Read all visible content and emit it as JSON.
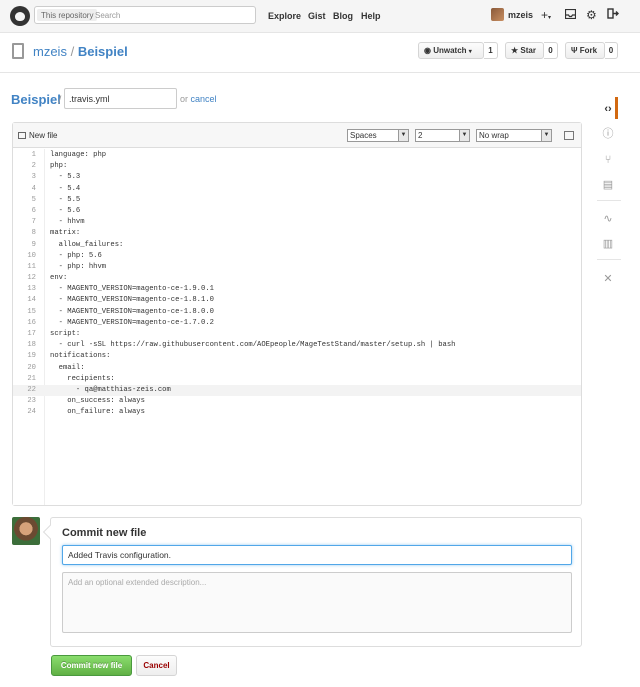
{
  "header": {
    "search_scope": "This repository",
    "search_placeholder": "Search",
    "nav": [
      "Explore",
      "Gist",
      "Blog",
      "Help"
    ],
    "username": "mzeis",
    "icons": [
      "plus-icon",
      "inbox-icon",
      "gear-icon",
      "sign-out-icon"
    ]
  },
  "repo": {
    "owner": "mzeis",
    "separator": "/",
    "name": "Beispiel",
    "watch_label": "Unwatch",
    "watch_count": "1",
    "star_label": "Star",
    "star_count": "0",
    "fork_label": "Fork",
    "fork_count": "0"
  },
  "sidebar": {
    "items": [
      "code-icon",
      "issues-icon",
      "pull-requests-icon",
      "wiki-icon",
      "pulse-icon",
      "graphs-icon",
      "settings-icon"
    ],
    "active_color": "#d26911"
  },
  "breadcrumb": {
    "repo": "Beispiel",
    "separator": "/",
    "filename": ".travis.yml",
    "or": "or",
    "cancel": "cancel"
  },
  "editor": {
    "new_file_label": "New file",
    "indent_mode": "Spaces",
    "indent_size": "2",
    "wrap_mode": "No wrap",
    "lines": [
      "language: php",
      "php:",
      "  - 5.3",
      "  - 5.4",
      "  - 5.5",
      "  - 5.6",
      "  - hhvm",
      "matrix:",
      "  allow_failures:",
      "  - php: 5.6",
      "  - php: hhvm",
      "env:",
      "  - MAGENTO_VERSION=magento-ce-1.9.0.1",
      "  - MAGENTO_VERSION=magento-ce-1.8.1.0",
      "  - MAGENTO_VERSION=magento-ce-1.8.0.0",
      "  - MAGENTO_VERSION=magento-ce-1.7.0.2",
      "script:",
      "  - curl -sSL https://raw.githubusercontent.com/AOEpeople/MageTestStand/master/setup.sh | bash",
      "notifications:",
      "  email:",
      "    recipients:",
      "      - qa@matthias-zeis.com",
      "    on_success: always",
      "    on_failure: always"
    ],
    "highlighted_line": 22
  },
  "commit": {
    "title": "Commit new file",
    "summary_value": "Added Travis configuration.",
    "description_placeholder": "Add an optional extended description...",
    "commit_button": "Commit new file",
    "cancel_button": "Cancel"
  }
}
